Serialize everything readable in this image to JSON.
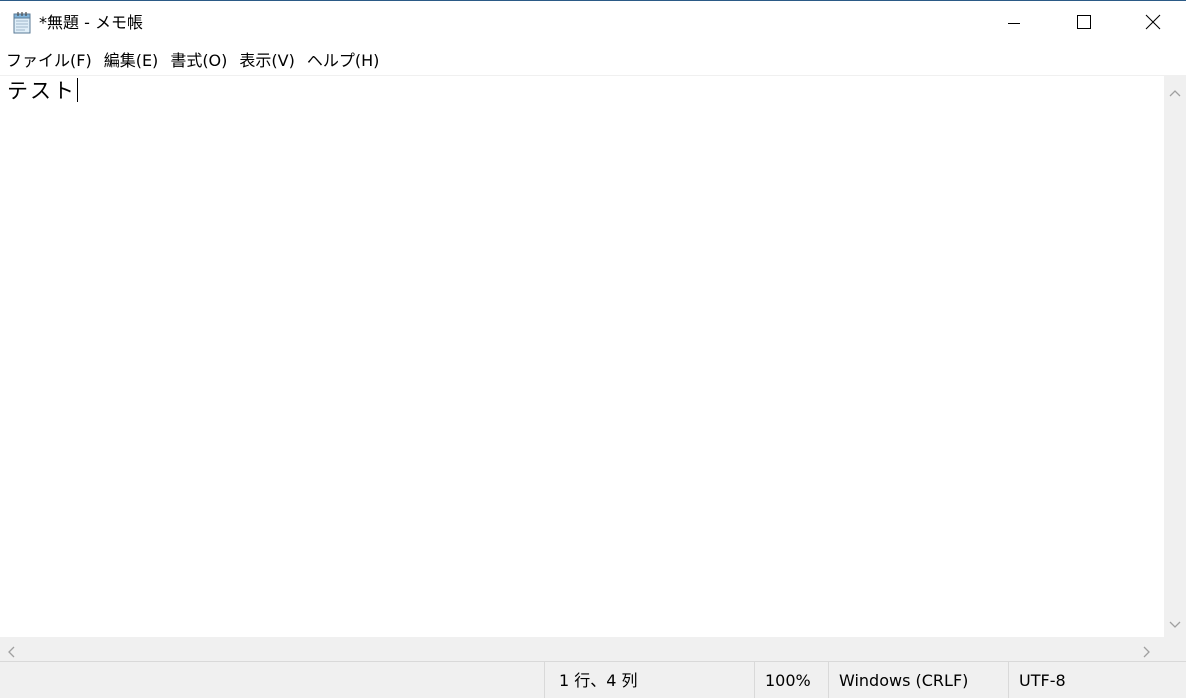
{
  "window": {
    "title": "*無題 - メモ帳",
    "icon": "notepad-icon",
    "controls": {
      "minimize_icon": "minimize-icon",
      "maximize_icon": "maximize-icon",
      "close_icon": "close-icon"
    }
  },
  "menubar": {
    "items": [
      {
        "label": "ファイル(F)"
      },
      {
        "label": "編集(E)"
      },
      {
        "label": "書式(O)"
      },
      {
        "label": "表示(V)"
      },
      {
        "label": "ヘルプ(H)"
      }
    ]
  },
  "editor": {
    "content": "テスト"
  },
  "statusbar": {
    "position": "1 行、4 列",
    "zoom": "100%",
    "line_ending": "Windows (CRLF)",
    "encoding": "UTF-8"
  },
  "colors": {
    "title_border": "#2b5a86",
    "chrome_bg": "#f0f0f0",
    "scroll_arrow": "#a0a0a0"
  }
}
